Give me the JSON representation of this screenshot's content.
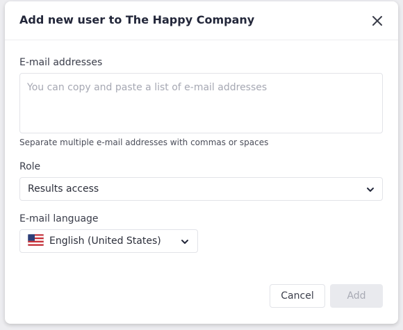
{
  "dialog": {
    "title": "Add new user to The Happy Company",
    "close_icon": "close-icon"
  },
  "email": {
    "label": "E-mail addresses",
    "placeholder": "You can copy and paste a list of e-mail addresses",
    "value": "",
    "hint": "Separate multiple e-mail addresses with commas or spaces"
  },
  "role": {
    "label": "Role",
    "selected": "Results access",
    "icon": "chevron-down-icon"
  },
  "language": {
    "label": "E-mail language",
    "selected": "English (United States)",
    "flag_icon": "us-flag-icon",
    "icon": "chevron-down-icon"
  },
  "actions": {
    "cancel_label": "Cancel",
    "add_label": "Add"
  },
  "colors": {
    "background": "#ededf0",
    "dialog": "#ffffff",
    "border": "#e2e3e8",
    "text": "#2b2e3a",
    "disabled_button": "#e9eaee",
    "disabled_text": "#a8aab4"
  }
}
